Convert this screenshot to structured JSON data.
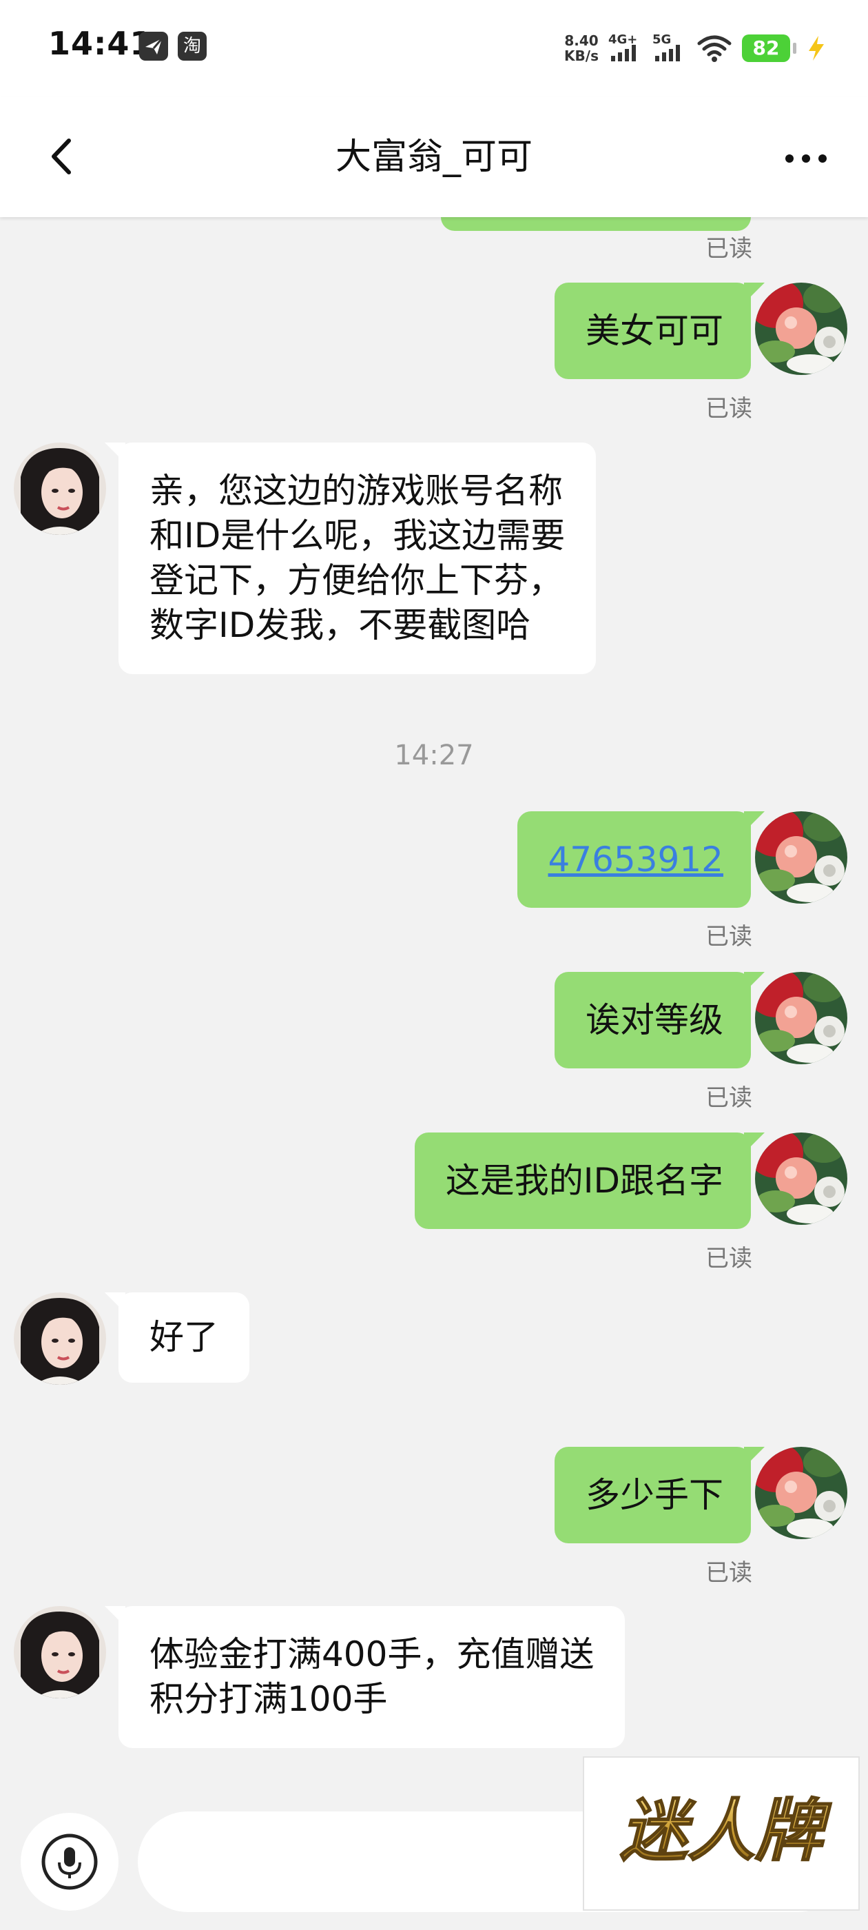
{
  "status_bar": {
    "time": "14:41",
    "app_icon_1": "paper-plane-icon",
    "app_icon_2": "淘",
    "net_speed_value": "8.40",
    "net_speed_unit": "KB/s",
    "signal_1_label": "4G+",
    "signal_2_label": "5G",
    "battery_level": "82",
    "battery_charging": true
  },
  "header": {
    "title": "大富翁_可可",
    "back_icon": "chevron-left-icon",
    "more_icon": "more-horizontal-icon"
  },
  "colors": {
    "sent_bubble": "#95dc74",
    "received_bubble": "#ffffff",
    "background": "#f2f2f2",
    "link": "#3a7fe0",
    "battery": "#4cd137"
  },
  "messages": [
    {
      "direction": "sent",
      "text": "",
      "status": "已读",
      "note": "partially visible bubble at top"
    },
    {
      "direction": "sent",
      "text": "美女可可",
      "status": "已读"
    },
    {
      "direction": "received",
      "text": "亲，您这边的游戏账号名称\n和ID是什么呢，我这边需要\n登记下，方便给你上下芬，\n数字ID发我，不要截图哈"
    },
    {
      "type": "timestamp",
      "text": "14:27"
    },
    {
      "direction": "sent",
      "text": "47653912",
      "is_link": true,
      "status": "已读"
    },
    {
      "direction": "sent",
      "text": "诶对等级",
      "status": "已读"
    },
    {
      "direction": "sent",
      "text": "这是我的ID跟名字",
      "status": "已读"
    },
    {
      "direction": "received",
      "text": "好了"
    },
    {
      "direction": "sent",
      "text": "多少手下",
      "status": "已读"
    },
    {
      "direction": "received",
      "text": "体验金打满400手，充值赠送\n积分打满100手"
    }
  ],
  "input_bar": {
    "voice_icon": "microphone-icon",
    "input_value": ""
  },
  "watermark": {
    "text": "迷人牌"
  }
}
